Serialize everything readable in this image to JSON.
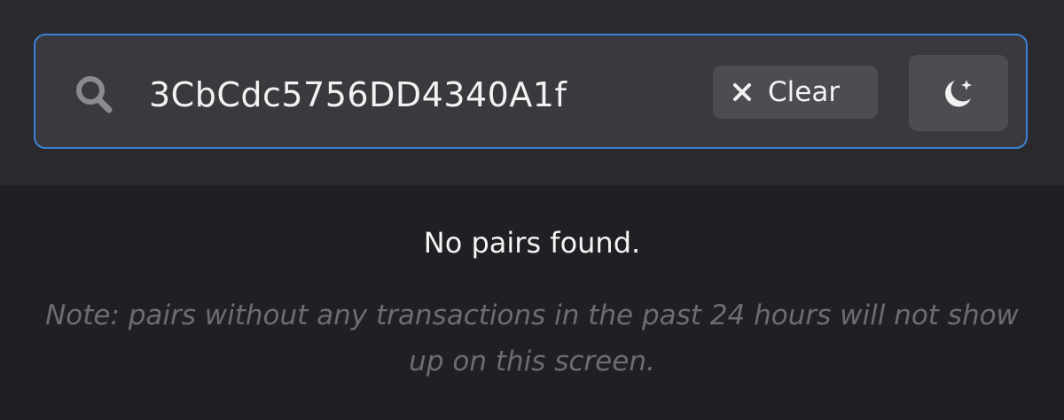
{
  "search": {
    "value": "3CbCdc5756DD4340A1f",
    "icon": "search-icon"
  },
  "clear_button": {
    "label": "Clear",
    "icon": "close-icon"
  },
  "theme_toggle": {
    "icon": "moon-icon"
  },
  "results": {
    "empty_message": "No pairs found.",
    "note": "Note: pairs without any transactions in the past 24 hours will not show up on this screen."
  },
  "colors": {
    "page_background": "#202024",
    "header_background": "#2a2a2e",
    "input_background": "#3a3a3e",
    "input_border_focus": "#3b82d4",
    "button_background": "#4c4c51",
    "text_primary": "#f2f2f2",
    "text_muted": "#6c6c72"
  }
}
